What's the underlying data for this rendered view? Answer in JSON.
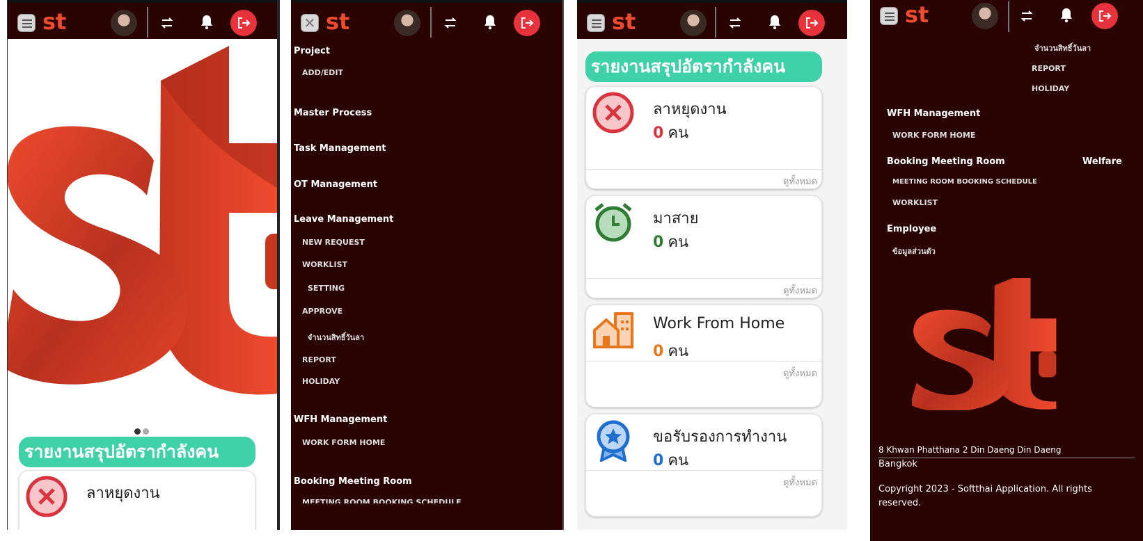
{
  "header": {
    "logo_text": "st"
  },
  "carousel": {
    "slides": 2,
    "active_slide": 1
  },
  "report": {
    "title": "รายงานสรุปอัตรากำลังคน",
    "unit": "คน",
    "view_all": "ดูทั้งหมด",
    "cards": [
      {
        "title": "ลาหยุดงาน",
        "count": "0",
        "color": "#d9333f",
        "icon": "cancel-circle-icon"
      },
      {
        "title": "มาสาย",
        "count": "0",
        "color": "#2e7d32",
        "icon": "alarm-clock-icon"
      },
      {
        "title": "Work From Home",
        "count": "0",
        "color": "#e8761d",
        "icon": "home-building-icon"
      },
      {
        "title": "ขอรับรองการทำงาน",
        "count": "0",
        "color": "#1e6fd0",
        "icon": "award-badge-icon"
      }
    ]
  },
  "sidebar": {
    "project": "Project",
    "add_edit": "ADD/EDIT",
    "master_process": "Master Process",
    "task_management": "Task Management",
    "ot_management": "OT Management",
    "leave_management": "Leave Management",
    "new_request": "NEW REQUEST",
    "worklist": "WORKLIST",
    "setting": "SETTING",
    "approve": "APPROVE",
    "leave_quota": "จำนวนสิทธิ์วันลา",
    "report": "REPORT",
    "holiday": "HOLIDAY",
    "wfh_management": "WFH Management",
    "work_form_home": "WORK FORM HOME",
    "booking_meeting_room": "Booking Meeting Room",
    "meeting_room_booking_schedule": "MEETING ROOM BOOKING SCHEDULE",
    "welfare": "Welfare",
    "booking_worklist": "WORKLIST",
    "employee": "Employee",
    "personal_info": "ข้อมูลส่วนตัว"
  },
  "footer": {
    "address_line1": "8 Khwan Phatthana 2 Din Daeng Din Daeng",
    "address_line2": "Bangkok",
    "copyright_line1": "Copyright 2023 - Softthai Application. All rights",
    "copyright_line2": "reserved."
  },
  "colors": {
    "topbar": "#2a0303",
    "accent_red": "#e8323c",
    "banner_green": "#3fd1a7",
    "brand_orange": "#ef4b2e"
  }
}
